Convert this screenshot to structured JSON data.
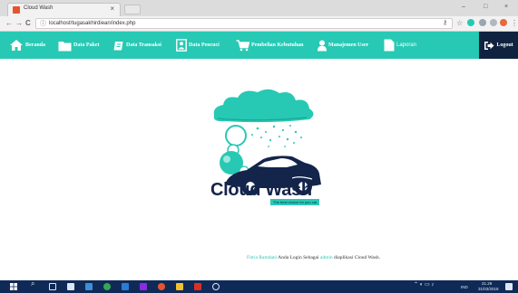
{
  "browser": {
    "tab_title": "Cloud Wash",
    "tab_close": "×",
    "window_controls": [
      "–",
      "□",
      "×"
    ],
    "nav": {
      "back": "←",
      "forward": "→",
      "reload": "C"
    },
    "url": "localhost/tugasakhirdiean/index.php"
  },
  "navbar": {
    "items": [
      {
        "label": "Beranda",
        "icon": "home-icon"
      },
      {
        "label": "Data Paket",
        "icon": "folder-icon"
      },
      {
        "label": "Data Transaksi",
        "icon": "edit-icon"
      },
      {
        "label": "Data Pencuci",
        "icon": "user-box-icon"
      },
      {
        "label": "Pembelian Kebutuhan",
        "icon": "cart-icon"
      },
      {
        "label": "Manajemen User",
        "icon": "users-icon"
      },
      {
        "label": "Laporan",
        "icon": "file-icon"
      }
    ],
    "logout_label": "Logout"
  },
  "logo": {
    "title": "Cloud Wash",
    "tagline": "The best choice for you car"
  },
  "footer": {
    "user_name": "Fitria Ramdani",
    "text1": " Anda Login Sebagai ",
    "role": "admin",
    "text2": " diaplikasi Cloud Wash."
  },
  "taskbar": {
    "lang": "IND",
    "time": "21.29",
    "date": "31/03/2018"
  },
  "colors": {
    "accent": "#27c9b4",
    "logout_bg": "#0f2340",
    "taskbar": "#102a57"
  }
}
